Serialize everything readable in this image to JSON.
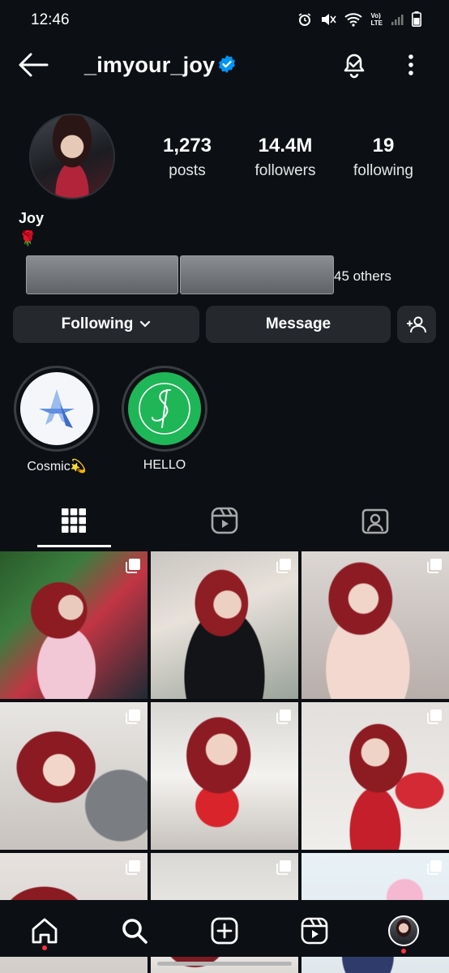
{
  "status_bar": {
    "time": "12:46",
    "icons": [
      "alarm-icon",
      "mute-icon",
      "wifi-icon",
      "volte-lte-icon",
      "signal-icon",
      "battery-icon"
    ],
    "volte_label": "Vo)",
    "lte_label": "LTE"
  },
  "header": {
    "username": "_imyour_joy",
    "verified": true,
    "accent_color": "#0095f6"
  },
  "profile": {
    "stats": {
      "posts_count": "1,273",
      "posts_label": "posts",
      "followers_count": "14.4M",
      "followers_label": "followers",
      "following_count": "19",
      "following_label": "following"
    },
    "name": "Joy",
    "bio": "🌹",
    "mutual_text": "45 others"
  },
  "actions": {
    "following_label": "Following",
    "message_label": "Message"
  },
  "highlights": [
    {
      "label": "Cosmic💫"
    },
    {
      "label": "HELLO"
    }
  ],
  "tabs": [
    "grid-icon",
    "reels-icon",
    "tagged-icon"
  ],
  "grid": {
    "rows_visible": 3,
    "columns": 3
  },
  "bottom_nav": [
    "home-icon",
    "search-icon",
    "create-icon",
    "reels-icon",
    "profile-avatar"
  ],
  "colors": {
    "background": "#0c1014",
    "button_bg": "#25292e",
    "notification_dot": "#ff3040",
    "hello_green": "#1fb657"
  }
}
